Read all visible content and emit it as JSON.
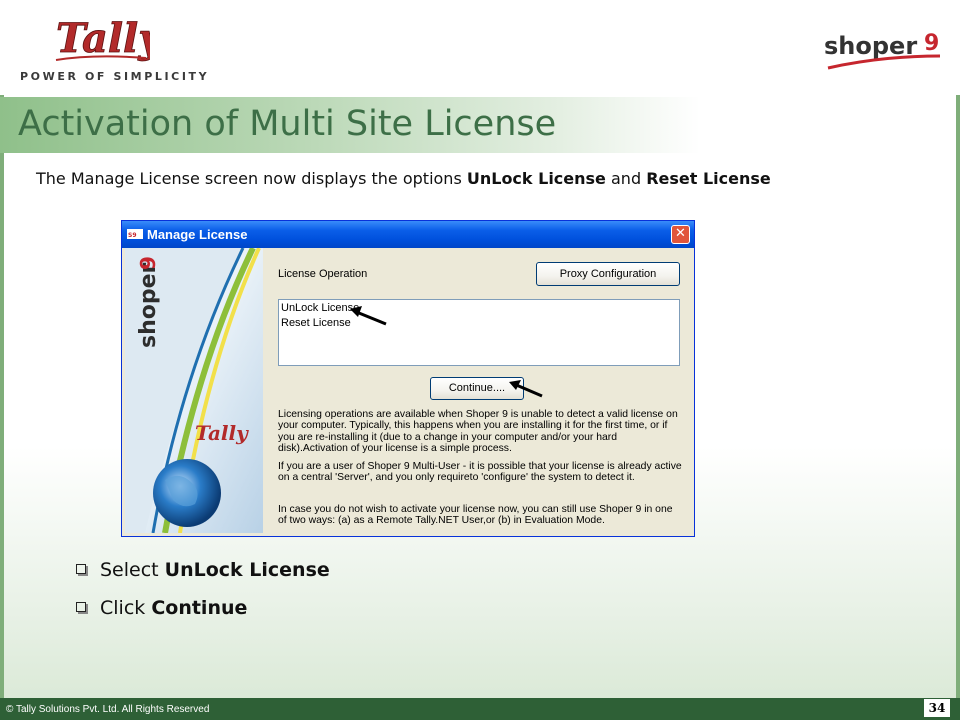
{
  "header": {
    "tally_logo_text": "Tally",
    "tally_tagline": "POWER OF SIMPLICITY",
    "shoper_logo_text": "shoper",
    "shoper_logo_number": "9"
  },
  "slide": {
    "title": "Activation of Multi Site License",
    "intro_pre": "The Manage License screen now displays the options ",
    "intro_bold1": "UnLock License",
    "intro_mid": " and ",
    "intro_bold2": "Reset License"
  },
  "dialog": {
    "title": "Manage License",
    "close_glyph": "✕",
    "section_label": "License Operation",
    "proxy_button": "Proxy Configuration",
    "list_items": [
      "UnLock License",
      "Reset License"
    ],
    "continue_button": "Continue....",
    "side_brand": "shoper",
    "side_brand_number": "9",
    "side_tally": "Tally",
    "info_paragraphs": [
      "Licensing operations are available when Shoper 9 is unable to detect a valid license on your computer. Typically, this happens when you are installing it for the first time, or if you are re-installing it (due to a change in your computer and/or your hard disk).Activation of your license is a simple process.",
      "If you are a user of Shoper 9 Multi-User - it is possible that your license is already active on a central 'Server', and you only requireto 'configure' the system to detect it.",
      "In case you do not wish to activate your license now, you can still use Shoper 9 in one of two ways: (a) as a Remote Tally.NET User,or (b) in Evaluation Mode."
    ]
  },
  "steps": [
    {
      "pre": "Select ",
      "bold": "UnLock License"
    },
    {
      "pre": "Click ",
      "bold": "Continue"
    }
  ],
  "footer": {
    "copyright": "© Tally Solutions Pvt. Ltd. All Rights Reserved",
    "page_number": "34"
  },
  "colors": {
    "title": "#3d6f47",
    "footer_bg": "#2e6036",
    "titlebar_blue": "#0050dc",
    "dialog_bg": "#ece9d8"
  }
}
